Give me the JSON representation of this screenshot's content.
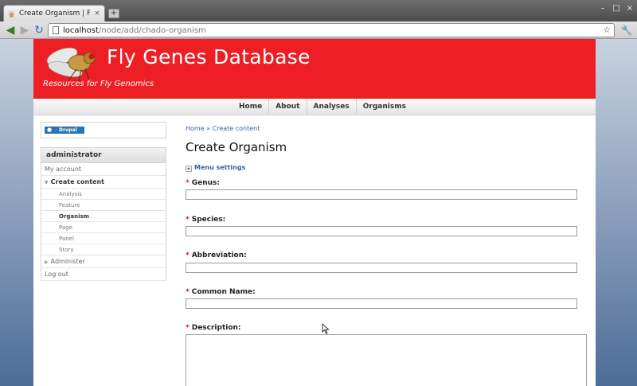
{
  "browser": {
    "tab_title": "Create Organism | Fly...",
    "new_tab_label": "+",
    "url_host": "localhost",
    "url_path": "/node/add/chado-organism",
    "back_glyph": "◀",
    "forward_glyph": "▶",
    "reload_glyph": "↻",
    "star_glyph": "☆",
    "wrench_glyph": "🔧",
    "close_glyph": "×"
  },
  "header": {
    "site_name": "Fly Genes Database",
    "site_slogan": "Resources for Fly Genomics",
    "background_color": "#ee1f24"
  },
  "primary_nav": {
    "items": [
      {
        "label": "Home"
      },
      {
        "label": "About"
      },
      {
        "label": "Analyses"
      },
      {
        "label": "Organisms"
      }
    ]
  },
  "sidebar": {
    "powered_by": "Drupal",
    "user_block_title": "administrator",
    "menu": [
      {
        "label": "My account",
        "level": 0
      },
      {
        "label": "Create content",
        "level": 0,
        "expanded": true
      },
      {
        "label": "Analysis",
        "level": 1
      },
      {
        "label": "Feature",
        "level": 1
      },
      {
        "label": "Organism",
        "level": 1,
        "active": true
      },
      {
        "label": "Page",
        "level": 1
      },
      {
        "label": "Panel",
        "level": 1
      },
      {
        "label": "Story",
        "level": 1
      },
      {
        "label": "Administer",
        "level": 0,
        "collapsed": true
      },
      {
        "label": "Log out",
        "level": 0
      }
    ]
  },
  "main": {
    "breadcrumb": {
      "home": "Home",
      "separator": "»",
      "current": "Create content"
    },
    "title": "Create Organism",
    "menu_settings": "Menu settings",
    "required_marker": "*",
    "fields": [
      {
        "label": "Genus:",
        "value": ""
      },
      {
        "label": "Species:",
        "value": ""
      },
      {
        "label": "Abbreviation:",
        "value": ""
      },
      {
        "label": "Common Name:",
        "value": ""
      },
      {
        "label": "Description:",
        "value": ""
      }
    ]
  }
}
